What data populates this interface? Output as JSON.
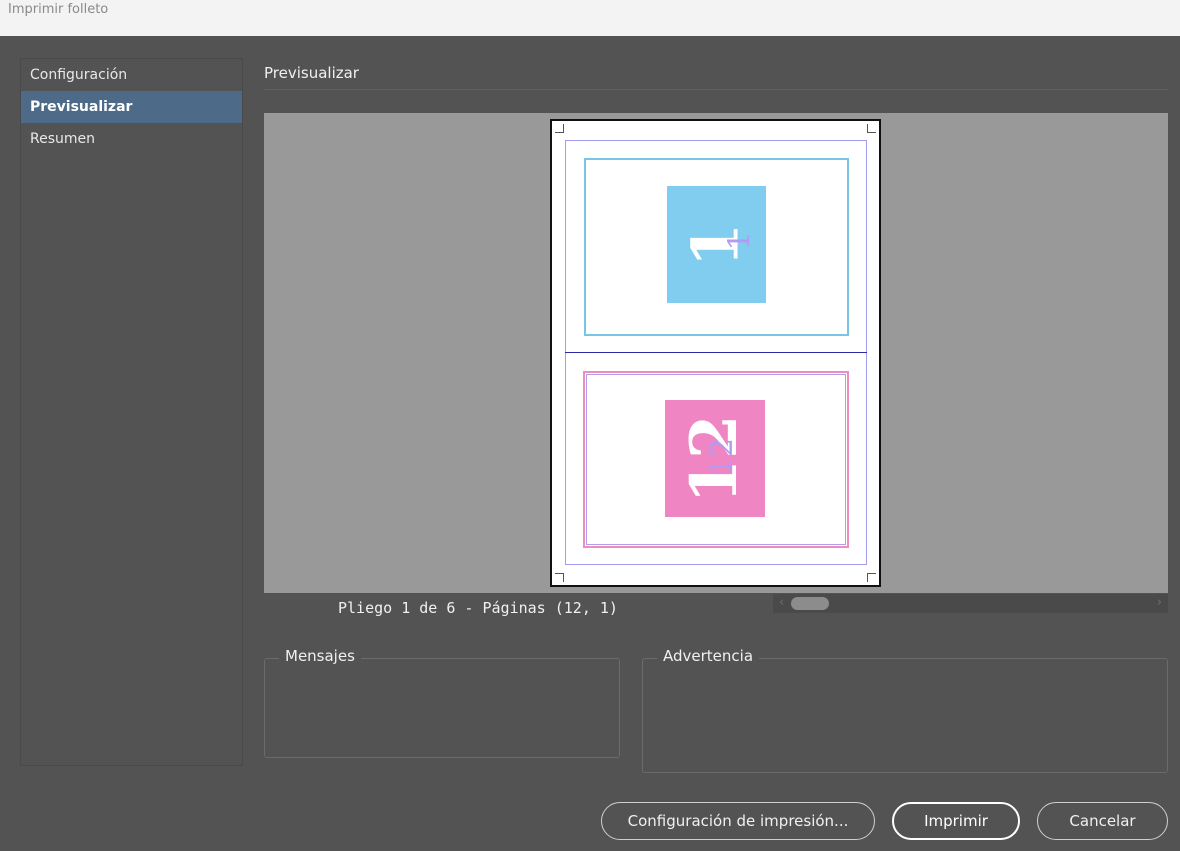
{
  "window": {
    "title": "Imprimir folleto"
  },
  "sidebar": {
    "items": [
      {
        "label": "Configuración",
        "active": false
      },
      {
        "label": "Previsualizar",
        "active": true
      },
      {
        "label": "Resumen",
        "active": false
      }
    ]
  },
  "preview": {
    "title": "Previsualizar",
    "spread_label": "Pliego 1 de 6 - Páginas (12, 1)",
    "top_page": {
      "number": "1",
      "color": "#80cdef",
      "frame_color": "#78c6e3"
    },
    "bottom_page": {
      "number": "12",
      "color": "#ef85c3",
      "frame_color": "#ee8cc2"
    },
    "scrollbar": {
      "left_arrow": "‹",
      "right_arrow": "›"
    }
  },
  "panels": {
    "messages_title": "Mensajes",
    "warning_title": "Advertencia"
  },
  "buttons": {
    "print_settings": "Configuración de impresión...",
    "print": "Imprimir",
    "cancel": "Cancelar"
  },
  "colors": {
    "background": "#535353",
    "active_nav": "#4e6a89",
    "preview_bg": "#999999"
  }
}
